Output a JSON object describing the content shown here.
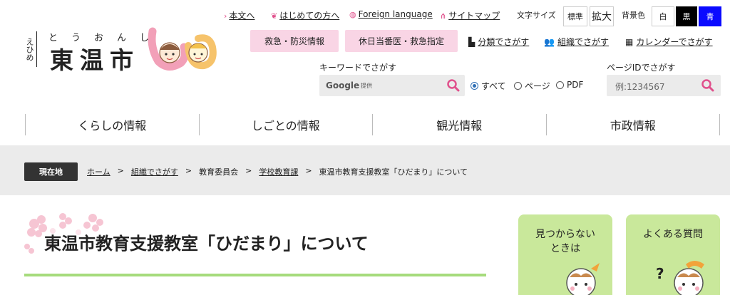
{
  "logo": {
    "prefecture": "えひめ",
    "ruby": "とうおんし",
    "city_name": "東温市"
  },
  "utility": {
    "skip_link": "本文へ",
    "first_time": "はじめての方へ",
    "foreign": "Foreign language",
    "sitemap": "サイトマップ",
    "font_size_label": "文字サイズ",
    "font_standard": "標準",
    "font_large": "拡大",
    "bg_color_label": "背景色",
    "bg_white": "白",
    "bg_black": "黒",
    "bg_blue": "青"
  },
  "quick": {
    "emergency": "救急・防災情報",
    "holiday_doctor": "休日当番医・救急指定",
    "by_category": "分類でさがす",
    "by_organization": "組織でさがす",
    "by_calendar": "カレンダーでさがす"
  },
  "search": {
    "keyword_label": "キーワードでさがす",
    "google": "Google",
    "google_sub": "提供",
    "scope_all": "すべて",
    "scope_page": "ページ",
    "scope_pdf": "PDF",
    "pageid_label": "ページIDでさがす",
    "pageid_placeholder": "例:1234567"
  },
  "global_nav": [
    "くらしの情報",
    "しごとの情報",
    "観光情報",
    "市政情報"
  ],
  "breadcrumb": {
    "here_label": "現在地",
    "items": [
      "ホーム",
      "組織でさがす",
      "教育委員会",
      "学校教育課",
      "東温市教育支援教室「ひだまり」について"
    ],
    "separator": ">"
  },
  "page": {
    "title": "東温市教育支援教室「ひだまり」について"
  },
  "side_cards": {
    "not_found": "見つからない\nときは",
    "faq": "よくある質問"
  },
  "colors": {
    "pink_pill": "#f9d5e5",
    "magnifier": "#e0508c",
    "green_card": "#c9e89b",
    "green_line": "#a6db7c",
    "bg_black": "#000000",
    "bg_blue": "#0a0aff",
    "crumb_bar": "#ebebeb"
  }
}
